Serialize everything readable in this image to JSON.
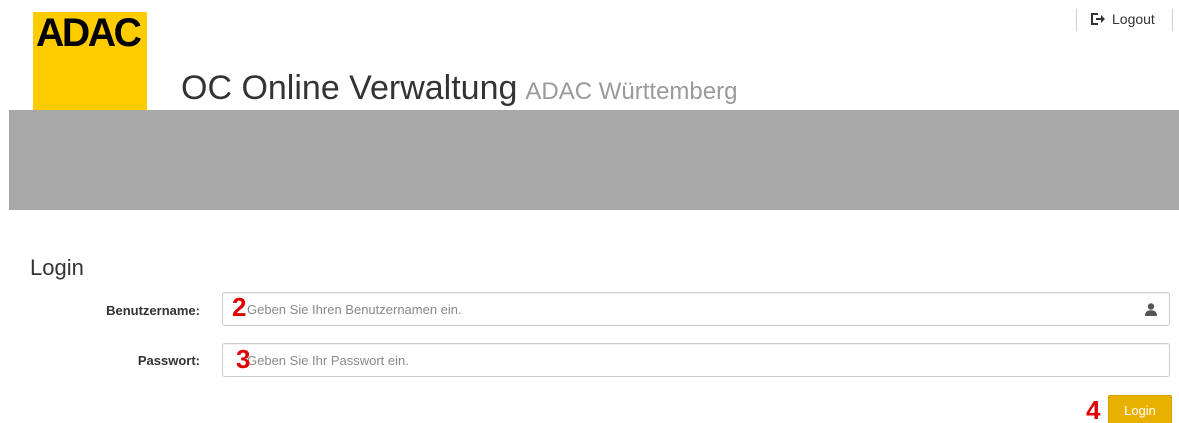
{
  "brand": {
    "logo_text": "ADAC",
    "logo_color": "#ffcc00"
  },
  "header": {
    "title": "OC Online Verwaltung",
    "subtitle": "ADAC Württemberg",
    "logout_label": "Logout",
    "logout_icon": "logout-icon"
  },
  "colors": {
    "banner": "#a8a8a8",
    "button": "#e8b000",
    "marker": "#e00000"
  },
  "login": {
    "title": "Login",
    "username": {
      "label": "Benutzername:",
      "placeholder": "Geben Sie Ihren Benutzernamen ein.",
      "value": "",
      "icon": "user-icon"
    },
    "password": {
      "label": "Passwort:",
      "placeholder": "Geben Sie Ihr Passwort ein.",
      "value": ""
    },
    "button_label": "Login"
  },
  "markers": {
    "username": "2",
    "password": "3",
    "button": "4"
  }
}
